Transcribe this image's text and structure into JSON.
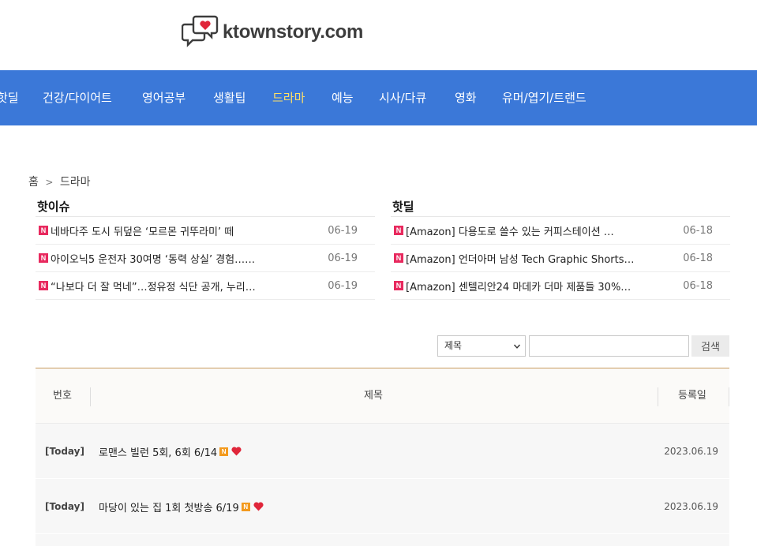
{
  "site": {
    "logo_text": "ktownstory.com"
  },
  "nav": {
    "items": [
      {
        "label": "핫딜",
        "active": false
      },
      {
        "label": "건강/다이어트",
        "active": false
      },
      {
        "label": "영어공부",
        "active": false
      },
      {
        "label": "생활팁",
        "active": false
      },
      {
        "label": "드라마",
        "active": true
      },
      {
        "label": "예능",
        "active": false
      },
      {
        "label": "시사/다큐",
        "active": false
      },
      {
        "label": "영화",
        "active": false
      },
      {
        "label": "유머/엽기/트랜드",
        "active": false
      }
    ],
    "bg_color": "#3b78d8",
    "active_color": "#ffe066"
  },
  "breadcrumb": {
    "home": "홈",
    "separator": ">",
    "current": "드라마"
  },
  "hot_issue": {
    "title": "핫이슈",
    "badge": "N",
    "items": [
      {
        "text": "네바다주 도시 뒤덮은 ‘모르몬 귀뚜라미’ 떼",
        "date": "06-19"
      },
      {
        "text": "아이오닉5 운전자 30여명 ‘동력 상실’ 경험……",
        "date": "06-19"
      },
      {
        "text": "“나보다 더 잘 먹네”…정유정 식단 공개, 누리…",
        "date": "06-19"
      }
    ]
  },
  "hot_deal": {
    "title": "핫딜",
    "badge": "N",
    "items": [
      {
        "text": "[Amazon] 다용도로 쓸수 있는 커피스테이션 …",
        "date": "06-18"
      },
      {
        "text": "[Amazon] 언더아머 남성 Tech Graphic Shorts…",
        "date": "06-18"
      },
      {
        "text": "[Amazon] 센텔리안24 마데카 더마 제품들 30%…",
        "date": "06-18"
      }
    ]
  },
  "search": {
    "select_value": "제목",
    "input_value": "",
    "button_label": "검색"
  },
  "board": {
    "headers": {
      "number": "번호",
      "title": "제목",
      "date": "등록일"
    },
    "rows": [
      {
        "tag": "[Today]",
        "title": "로맨스 빌런 5회, 6회 6/14",
        "badge": "N",
        "date": "2023.06.19"
      },
      {
        "tag": "[Today]",
        "title": "마당이 있는 집 1회 첫방송 6/19",
        "badge": "N",
        "date": "2023.06.19"
      }
    ]
  },
  "colors": {
    "badge_pink": "#e8295e",
    "badge_orange": "#f39a1e",
    "heart": "#e0263a",
    "board_border": "#c89b5e"
  }
}
